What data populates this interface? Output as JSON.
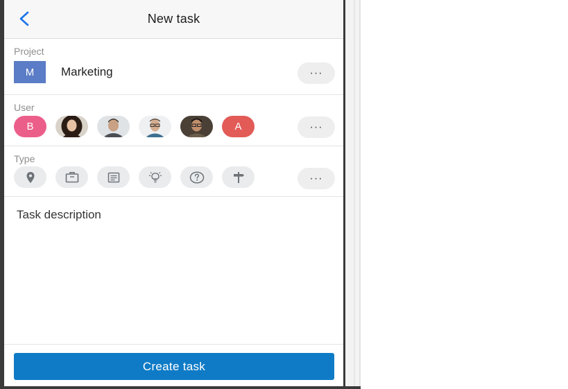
{
  "header": {
    "title": "New task",
    "back_icon": "chevron-left-icon"
  },
  "project": {
    "label": "Project",
    "badge": "M",
    "name": "Marketing",
    "badge_color": "#5b7cc6",
    "more": "···"
  },
  "user": {
    "label": "User",
    "more": "···",
    "avatars": [
      {
        "type": "initial",
        "text": "B",
        "color": "#ec5e8a"
      },
      {
        "type": "photo",
        "name": "user-photo-woman"
      },
      {
        "type": "photo",
        "name": "user-photo-man-1"
      },
      {
        "type": "photo",
        "name": "user-photo-man-glasses"
      },
      {
        "type": "photo",
        "name": "user-photo-man-2"
      },
      {
        "type": "initial",
        "text": "A",
        "color": "#e25b57"
      }
    ]
  },
  "type": {
    "label": "Type",
    "more": "···",
    "icons": [
      "location-pin-icon",
      "briefcase-icon",
      "document-icon",
      "lightbulb-icon",
      "question-icon",
      "signpost-icon"
    ]
  },
  "description": {
    "placeholder": "Task description"
  },
  "footer": {
    "create_label": "Create task",
    "button_color": "#0f7bc6"
  }
}
